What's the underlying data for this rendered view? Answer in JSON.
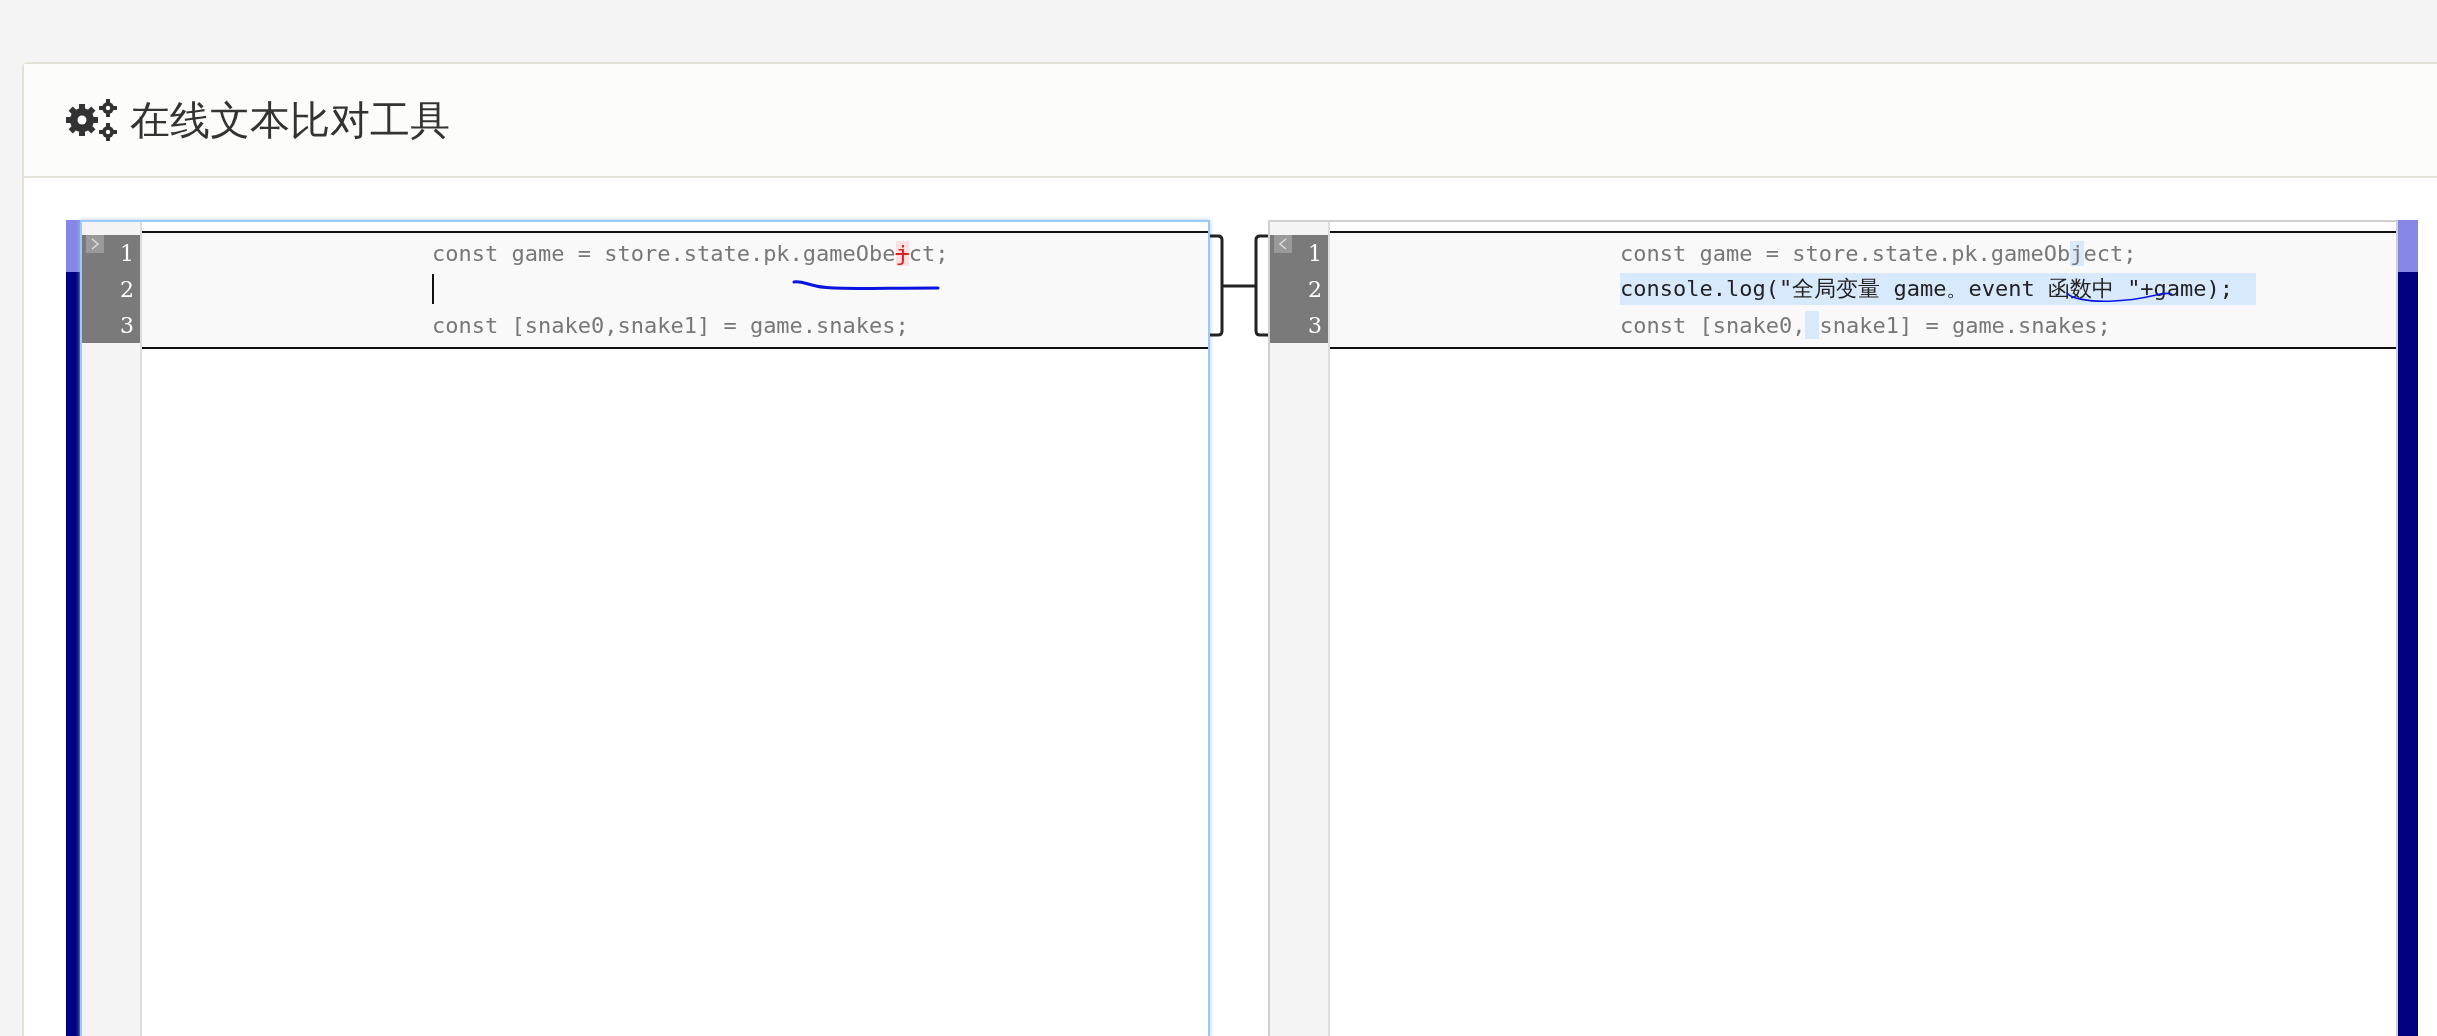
{
  "header": {
    "title": "在线文本比对工具"
  },
  "left_editor": {
    "lines": [
      {
        "number": "1",
        "segments": [
          {
            "kind": "plain",
            "text": "const game = store.state.pk.gameObe"
          },
          {
            "kind": "deleted",
            "text": "j"
          },
          {
            "kind": "plain",
            "text": "ct;"
          }
        ]
      },
      {
        "number": "2",
        "cursor": true
      },
      {
        "number": "3",
        "segments": [
          {
            "kind": "plain",
            "text": "const [snake0,snake1] = game.snakes;"
          }
        ]
      }
    ]
  },
  "right_editor": {
    "lines": [
      {
        "number": "1",
        "segments": [
          {
            "kind": "plain",
            "text": "const game = store.state.pk.gameOb"
          },
          {
            "kind": "inserted",
            "text": "j"
          },
          {
            "kind": "plain",
            "text": "ect;"
          }
        ]
      },
      {
        "number": "2",
        "inserted": true,
        "segments": [
          {
            "kind": "inserted",
            "text": "console.log(\"全局变量 game。event 函数中 \"+game);"
          }
        ]
      },
      {
        "number": "3",
        "segments": [
          {
            "kind": "plain",
            "text": "const [snake0,"
          },
          {
            "kind": "inserted_space"
          },
          {
            "kind": "plain",
            "text": "snake1] = game.snakes;"
          }
        ]
      }
    ]
  }
}
